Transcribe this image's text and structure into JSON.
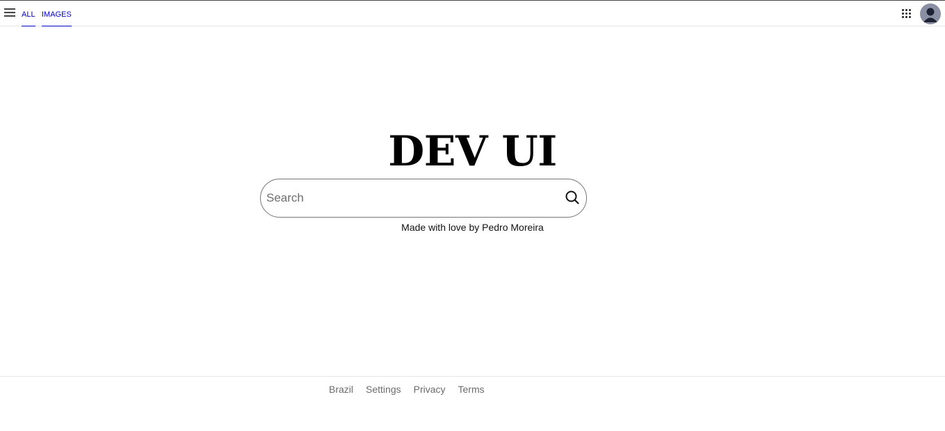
{
  "header": {
    "tabs": [
      {
        "label": "ALL"
      },
      {
        "label": "IMAGES"
      }
    ],
    "menu_icon": "hamburger-menu-icon",
    "apps_icon": "apps-grid-icon",
    "avatar_icon": "user-avatar-icon",
    "tab_color": "#0000cc"
  },
  "main": {
    "logo": "DEV UI",
    "search": {
      "placeholder": "Search",
      "value": "",
      "icon": "search-icon"
    },
    "tagline": "Made with love by Pedro Moreira"
  },
  "footer": {
    "links": [
      {
        "label": "Brazil"
      },
      {
        "label": "Settings"
      },
      {
        "label": "Privacy"
      },
      {
        "label": "Terms"
      }
    ]
  }
}
